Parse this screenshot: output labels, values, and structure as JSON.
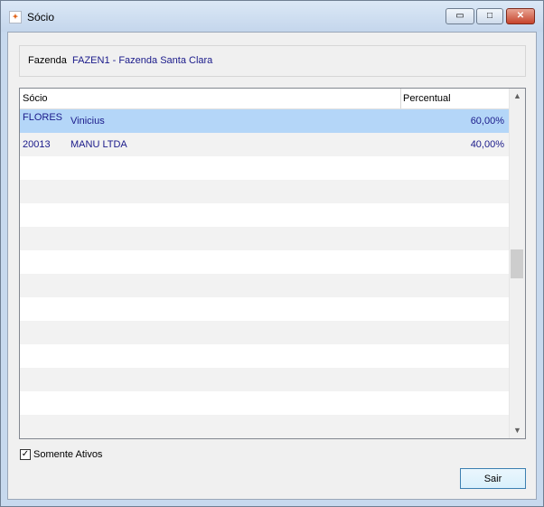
{
  "window": {
    "title": "Sócio",
    "icon": "app-logo-icon",
    "controls": {
      "minimize": "▭",
      "maximize": "□",
      "close": "✕"
    }
  },
  "fazenda": {
    "label": "Fazenda",
    "value": "FAZEN1 - Fazenda Santa Clara"
  },
  "grid": {
    "columns": [
      "Sócio",
      "Percentual"
    ],
    "rows": [
      {
        "code": "FLORES",
        "name": "Vinicius",
        "percent": "60,00%",
        "selected": true
      },
      {
        "code": "20013",
        "name": "MANU LTDA",
        "percent": "40,00%",
        "selected": false
      }
    ],
    "empty_rows": 12
  },
  "filter": {
    "label": "Somente Ativos",
    "checked": true,
    "check_glyph": "✓"
  },
  "actions": {
    "exit_label": "Sair"
  },
  "scroll": {
    "up_glyph": "▲",
    "down_glyph": "▼"
  },
  "colors": {
    "selected_row": "#b4d6f8",
    "text_value": "#1a1a8a"
  }
}
